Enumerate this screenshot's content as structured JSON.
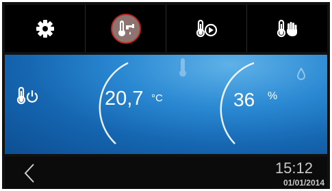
{
  "toolbar": {
    "items": [
      {
        "icon": "gear-icon"
      },
      {
        "icon": "thermometer-faucet-icon",
        "active": true
      },
      {
        "icon": "thermometer-play-icon"
      },
      {
        "icon": "thermometer-hand-icon"
      }
    ]
  },
  "main": {
    "power_icon": "thermometer-power-icon",
    "temperature": {
      "value": "20,7",
      "unit": "°C"
    },
    "humidity": {
      "value": "36",
      "unit": "%"
    }
  },
  "footer": {
    "time": "15:12",
    "date": "01/01/2014"
  },
  "colors": {
    "active_ring": "#b8261f",
    "panel_blue": "#1e74c2",
    "icon_white": "#ffffff"
  }
}
